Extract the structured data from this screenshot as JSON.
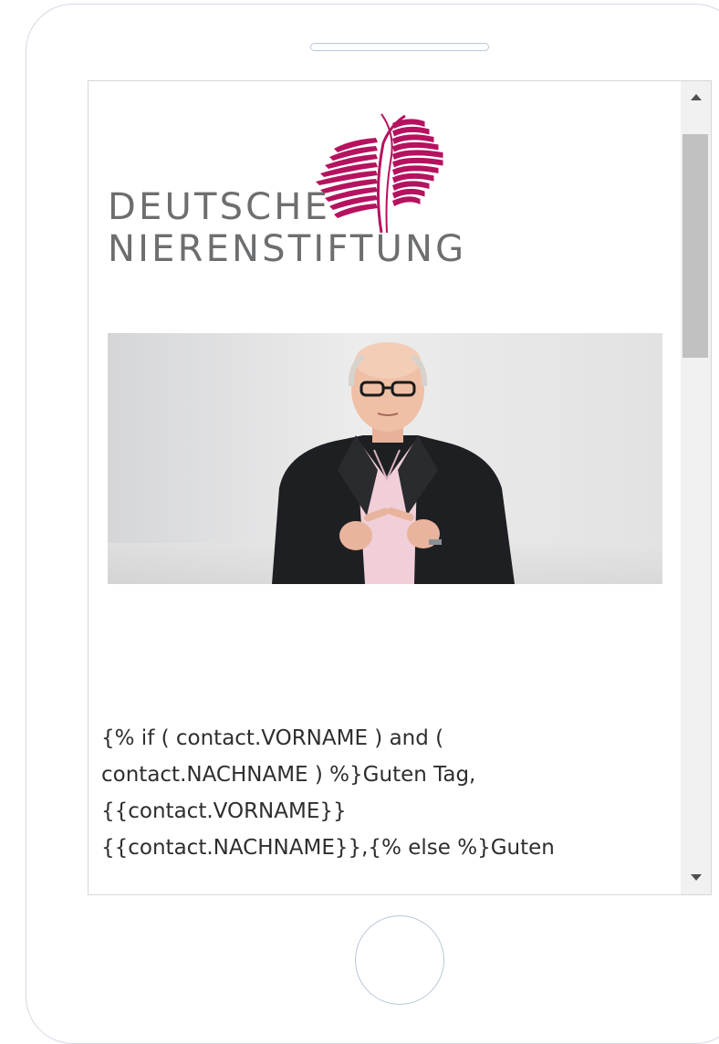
{
  "logo": {
    "line1": "DEUTSCHE",
    "line2": "NIERENSTIFTUNG",
    "text_color": "#6d6e70",
    "mark_color": "#b5125f"
  },
  "hero_image": {
    "description_icon": "photo-person-pointing",
    "background_color": "#e4e4e4"
  },
  "email_body": {
    "lines": [
      "{% if ( contact.VORNAME ) and (",
      "contact.NACHNAME ) %}Guten Tag,",
      "{{contact.VORNAME}}",
      "{{contact.NACHNAME}},{% else %}Guten"
    ]
  },
  "scroll": {
    "position": 0.0
  }
}
